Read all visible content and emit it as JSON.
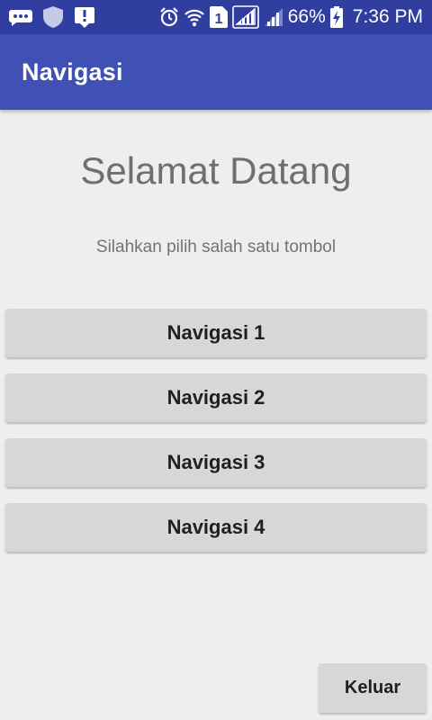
{
  "status_bar": {
    "sim_number": "1",
    "battery": "66%",
    "time": "7:36 PM",
    "icons": [
      "message-icon",
      "shield-icon",
      "download-alert-icon",
      "alarm-icon",
      "wifi-icon",
      "sim-icon",
      "signal-icon",
      "signal-icon-2",
      "battery-charging-icon"
    ]
  },
  "app_bar": {
    "title": "Navigasi",
    "color": "#3f51b5"
  },
  "main": {
    "welcome": "Selamat Datang",
    "subtitle": "Silahkan pilih salah satu tombol",
    "buttons": [
      {
        "label": "Navigasi 1"
      },
      {
        "label": "Navigasi 2"
      },
      {
        "label": "Navigasi 3"
      },
      {
        "label": "Navigasi 4"
      }
    ],
    "exit_label": "Keluar"
  }
}
